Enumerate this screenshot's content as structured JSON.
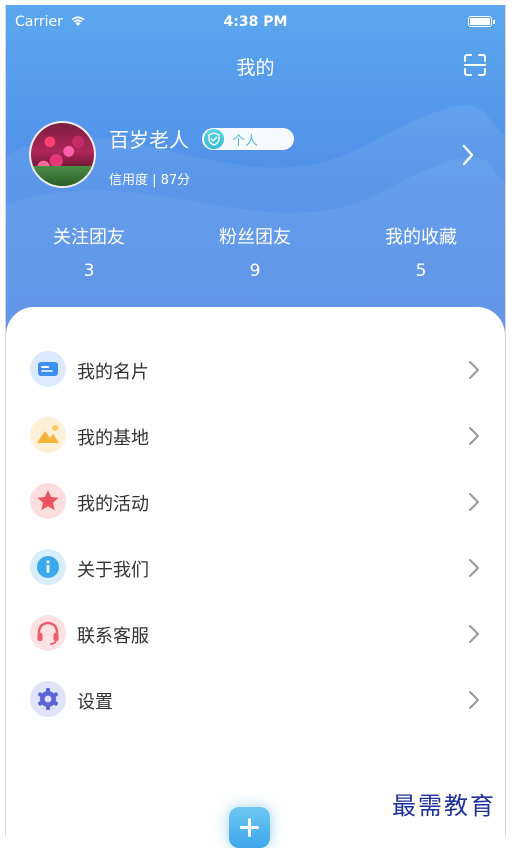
{
  "status_bar": {
    "carrier": "Carrier",
    "time": "4:38 PM"
  },
  "nav": {
    "title": "我的",
    "scan_icon": "scan-icon"
  },
  "profile": {
    "name": "百岁老人",
    "badge": "个人",
    "credit": "信用度 | 87分"
  },
  "stats": [
    {
      "label": "关注团友",
      "value": "3"
    },
    {
      "label": "粉丝团友",
      "value": "9"
    },
    {
      "label": "我的收藏",
      "value": "5"
    }
  ],
  "menu": [
    {
      "label": "我的名片",
      "icon": "business-card-icon",
      "color": "#3f8ff0"
    },
    {
      "label": "我的基地",
      "icon": "mountain-base-icon",
      "color": "#f7b23b"
    },
    {
      "label": "我的活动",
      "icon": "star-icon",
      "color": "#f0505e"
    },
    {
      "label": "关于我们",
      "icon": "info-icon",
      "color": "#3aa8ea"
    },
    {
      "label": "联系客服",
      "icon": "headset-icon",
      "color": "#f05b6a"
    },
    {
      "label": "设置",
      "icon": "gear-icon",
      "color": "#5a63d8"
    }
  ],
  "colors": {
    "header_top": "#5aa7ee",
    "header_bottom": "#4d86e6",
    "text": "#333333",
    "arrow": "#999999"
  },
  "watermark": "最需教育"
}
